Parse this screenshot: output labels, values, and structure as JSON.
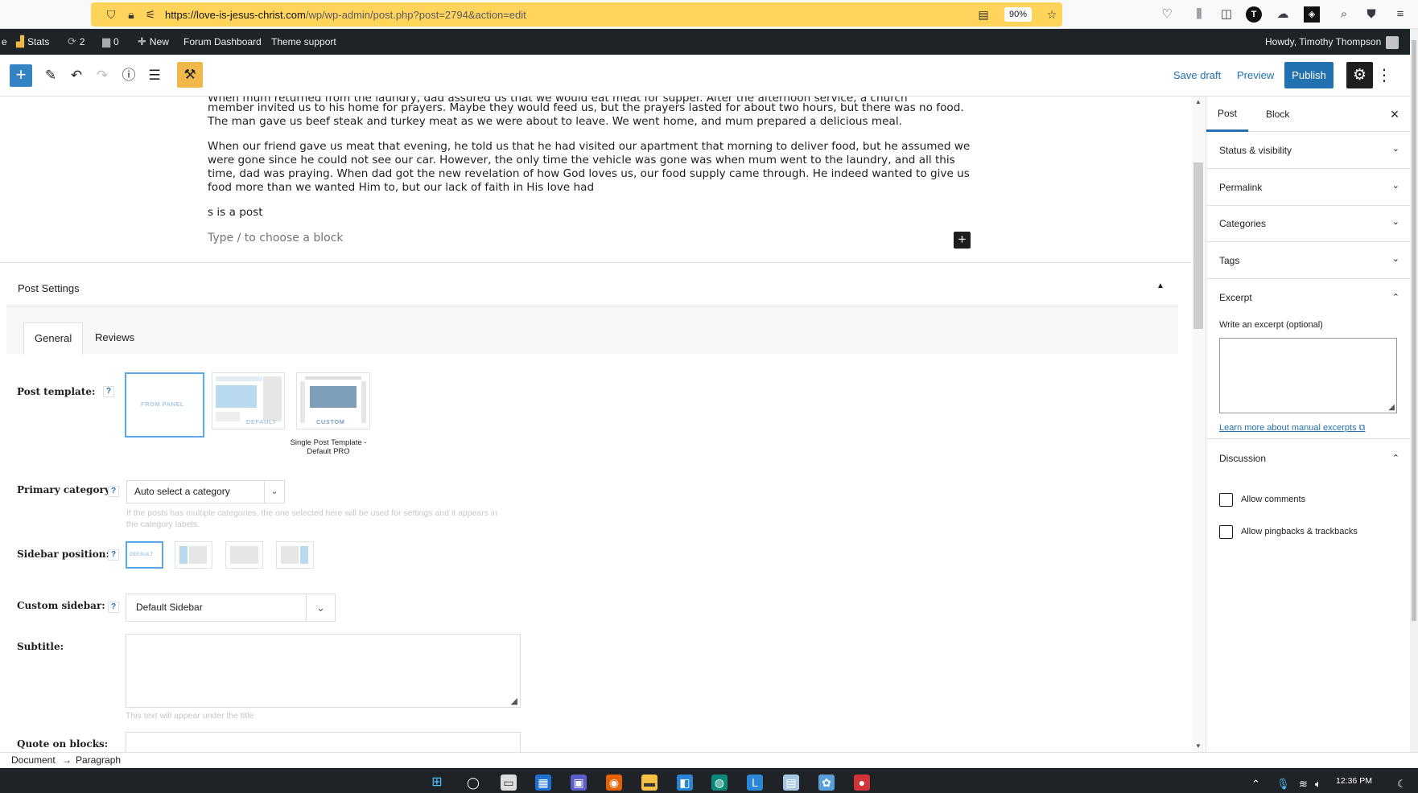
{
  "browser": {
    "url_host": "https://love-is-jesus-christ.com",
    "url_path": "/wp/wp-admin/post.php?post=2794&action=edit",
    "zoom": "90%"
  },
  "admin_bar": {
    "site_fragment": "e",
    "stats": "Stats",
    "updates_count": "2",
    "comments_count": "0",
    "new": "New",
    "forum_dashboard": "Forum Dashboard",
    "theme_support": "Theme support",
    "howdy": "Howdy, Timothy Thompson"
  },
  "toolbar": {
    "save_draft": "Save draft",
    "preview": "Preview",
    "publish": "Publish"
  },
  "content": {
    "partial_top_line": "When mum returned from the laundry, dad assured us that we would eat meat for supper. After the afternoon service, a church",
    "paragraph1": "member invited us to his home for prayers. Maybe they would feed us, but the prayers lasted for about two hours, but there was no food. The man gave us beef steak and turkey meat as we were about to leave. We went home, and mum prepared a delicious meal.",
    "paragraph2": "When our friend gave us meat that evening, he told us that he had visited our apartment that morning to deliver food, but he assumed we were gone since he could not see our car. However, the only time the vehicle was gone was when mum went to the laundry, and all this time, dad was praying. When dad got the new revelation of how God loves us, our food supply came through. He indeed wanted to give us food more than we wanted Him to, but our lack of faith in His love had",
    "paragraph3": "s is a post",
    "appender_placeholder": "Type / to choose a block"
  },
  "post_settings": {
    "title": "Post Settings",
    "tabs": [
      "General",
      "Reviews"
    ],
    "post_template_label": "Post template:",
    "template_options": [
      "FROM PANEL",
      "DEFAULT",
      "CUSTOM"
    ],
    "custom_template_caption": "Single Post Template - Default PRO",
    "primary_category_label": "Primary category:",
    "primary_category_value": "Auto select a category",
    "primary_category_hint": "If the posts has multiple categories, the one selected here will be used for settings and it appears in the category labels.",
    "sidebar_position_label": "Sidebar position:",
    "sidebar_default": "DEFAULT",
    "custom_sidebar_label": "Custom sidebar:",
    "custom_sidebar_value": "Default Sidebar",
    "subtitle_label": "Subtitle:",
    "subtitle_hint": "This text will appear under the title",
    "quote_label": "Quote on blocks:",
    "help": "?"
  },
  "sidebar": {
    "tabs": [
      "Post",
      "Block"
    ],
    "panels": [
      "Status & visibility",
      "Permalink",
      "Categories",
      "Tags",
      "Excerpt",
      "Discussion"
    ],
    "excerpt_label": "Write an excerpt (optional)",
    "excerpt_link": "Learn more about manual excerpts",
    "allow_comments": "Allow comments",
    "allow_pingbacks": "Allow pingbacks & trackbacks"
  },
  "footer": {
    "breadcrumb_document": "Document",
    "breadcrumb_arrow": "→",
    "breadcrumb_paragraph": "Paragraph"
  },
  "taskbar": {
    "time": "12:36 PM"
  },
  "colors": {
    "wp_blue": "#2271b1",
    "admin_bar": "#1d2327",
    "url_bar": "#ffd45a",
    "tools_active": "#f0b849"
  }
}
